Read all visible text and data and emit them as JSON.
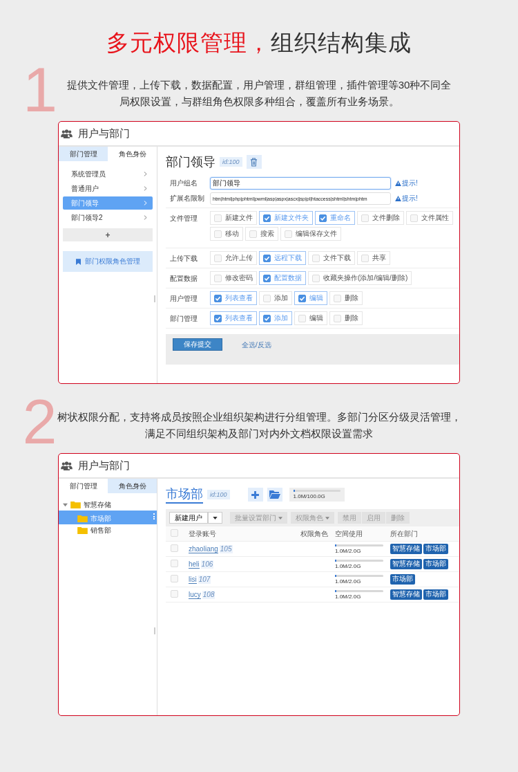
{
  "sections": [
    {
      "number": "1",
      "title_parts": [
        {
          "text": "多元权限管理，",
          "highlight": true
        },
        {
          "text": "组织结构集成",
          "highlight": false
        }
      ],
      "description": "提供文件管理，上传下载，数据配置，用户管理，群组管理，插件管理等30种不同全局权限设置，与群组角色权限多种组合，覆盖所有业务场景。",
      "panel": {
        "kind": "roles",
        "header": "用户与部门",
        "tabs": [
          {
            "label": "部门管理",
            "selected": false
          },
          {
            "label": "角色身份",
            "selected": true
          }
        ],
        "roles": [
          {
            "label": "系统管理员",
            "selected": false
          },
          {
            "label": "普通用户",
            "selected": false
          },
          {
            "label": "部门领导",
            "selected": true
          },
          {
            "label": "部门领导2",
            "selected": false
          }
        ],
        "add_button": "+",
        "manage_link": "部门权限角色管理",
        "heading": "部门领导",
        "id_badge": "id:100",
        "fields": [
          {
            "label": "用户组名",
            "value": "部门领导",
            "focused": true,
            "hint": "提示!"
          },
          {
            "label": "扩展名限制",
            "value": "htm|html|php|phtml|pwml|asp|aspx|ascx|jsp|pl|htaccess|shtml|shtm|phtm",
            "focused": false,
            "hint": "提示!"
          }
        ],
        "permission_groups": [
          {
            "label": "文件管理",
            "options": [
              {
                "label": "新建文件",
                "checked": false
              },
              {
                "label": "新建文件夹",
                "checked": true
              },
              {
                "label": "重命名",
                "checked": true
              },
              {
                "label": "文件删除",
                "checked": false
              },
              {
                "label": "文件属性",
                "checked": false
              },
              {
                "label": "移动",
                "checked": false
              },
              {
                "label": "搜索",
                "checked": false
              },
              {
                "label": "编辑保存文件",
                "checked": false
              }
            ]
          },
          {
            "label": "上传下载",
            "options": [
              {
                "label": "允许上传",
                "checked": false
              },
              {
                "label": "远程下载",
                "checked": true
              },
              {
                "label": "文件下载",
                "checked": false
              },
              {
                "label": "共享",
                "checked": false
              }
            ]
          },
          {
            "label": "配置数据",
            "options": [
              {
                "label": "修改密码",
                "checked": false
              },
              {
                "label": "配置数据",
                "checked": true
              },
              {
                "label": "收藏夹操作(添加/编辑/删除)",
                "checked": false
              }
            ]
          },
          {
            "label": "用户管理",
            "options": [
              {
                "label": "列表查看",
                "checked": true
              },
              {
                "label": "添加",
                "checked": false
              },
              {
                "label": "编辑",
                "checked": true
              },
              {
                "label": "删除",
                "checked": false
              }
            ]
          },
          {
            "label": "部门管理",
            "options": [
              {
                "label": "列表查看",
                "checked": true
              },
              {
                "label": "添加",
                "checked": true
              },
              {
                "label": "编辑",
                "checked": false
              },
              {
                "label": "删除",
                "checked": false
              }
            ]
          }
        ],
        "save_button": "保存提交",
        "select_all_link": "全选/反选"
      }
    },
    {
      "number": "2",
      "description": "树状权限分配，支持将成员按照企业组织架构进行分组管理。多部门分区分级灵活管理，满足不同组织架构及部门对内外文档权限设置需求",
      "panel": {
        "kind": "departments",
        "header": "用户与部门",
        "tabs": [
          {
            "label": "部门管理",
            "selected": true
          },
          {
            "label": "角色身份",
            "selected": false
          }
        ],
        "tree": [
          {
            "label": "智慧存储",
            "expanded": true,
            "selected": false,
            "children": [
              {
                "label": "市场部",
                "selected": true
              },
              {
                "label": "销售部",
                "selected": false
              }
            ]
          }
        ],
        "heading": "市场部",
        "id_badge": "id:100",
        "quota": {
          "level": 0,
          "reading": "1.0M/100.0G"
        },
        "toolbar": [
          {
            "label": "新建用户",
            "kind": "split"
          },
          {
            "label": "批量设置部门",
            "kind": "dropdown"
          },
          {
            "label": "权限角色",
            "kind": "dropdown"
          },
          {
            "label": "禁用",
            "kind": "plain"
          },
          {
            "label": "启用",
            "kind": "plain"
          },
          {
            "label": "删除",
            "kind": "plain"
          }
        ],
        "columns": [
          "登录账号",
          "权限角色",
          "空间使用",
          "所在部门"
        ],
        "all_checked": false,
        "rows": [
          {
            "checked": false,
            "account": "zhaoliang",
            "id": "105",
            "usage": {
              "level": 0,
              "reading": "1.0M/2.0G"
            },
            "departments": [
              "智慧存储",
              "市场部"
            ]
          },
          {
            "checked": false,
            "account": "heli",
            "id": "106",
            "usage": {
              "level": 0,
              "reading": "1.0M/2.0G"
            },
            "departments": [
              "智慧存储",
              "市场部"
            ]
          },
          {
            "checked": false,
            "account": "lisi",
            "id": "107",
            "usage": {
              "level": 0,
              "reading": "1.0M/2.0G"
            },
            "departments": [
              "市场部"
            ]
          },
          {
            "checked": false,
            "account": "lucy",
            "id": "108",
            "usage": {
              "level": 0,
              "reading": "1.0M/2.0G"
            },
            "departments": [
              "智慧存储",
              "市场部"
            ]
          }
        ]
      }
    }
  ]
}
